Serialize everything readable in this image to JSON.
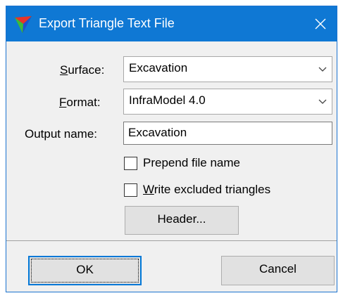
{
  "window": {
    "title": "Export Triangle Text File",
    "close_label": "✕"
  },
  "form": {
    "surface": {
      "label_underlined": "S",
      "label_rest": "urface:",
      "value": "Excavation"
    },
    "format": {
      "label_underlined": "F",
      "label_rest": "ormat:",
      "value": "InfraModel 4.0"
    },
    "output_name": {
      "label": "Output name:",
      "value": "Excavation"
    },
    "prepend_file_name": {
      "label": "Prepend file name",
      "checked": false
    },
    "write_excluded": {
      "label_underlined": "W",
      "label_rest": "rite excluded triangles",
      "checked": false
    },
    "header_button": "Header..."
  },
  "footer": {
    "ok": "OK",
    "cancel": "Cancel"
  },
  "colors": {
    "titlebar": "#0f78d4",
    "dialog_bg": "#f0f0f0",
    "button_bg": "#e1e1e1",
    "default_border": "#0078d7"
  },
  "icons": {
    "app": "triangle-app-icon",
    "close": "close-icon",
    "dropdown": "chevron-down-icon"
  }
}
